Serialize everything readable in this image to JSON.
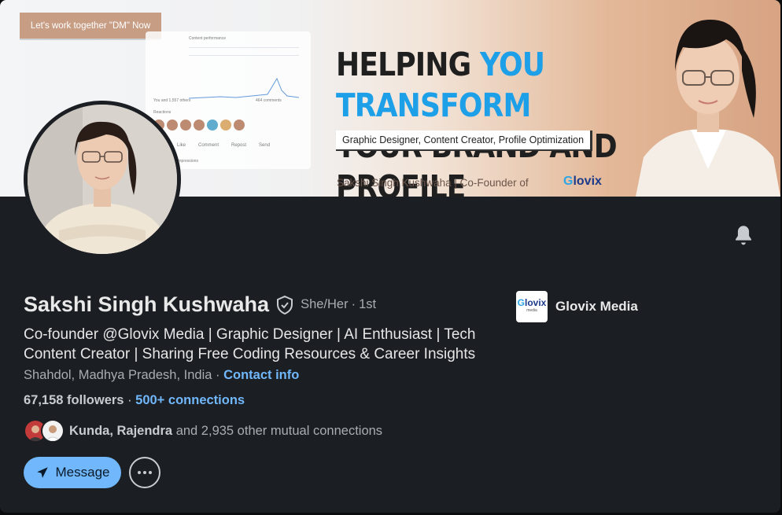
{
  "banner": {
    "tag_chip": "Let's work together \"DM\" Now",
    "mock_post": {
      "title": "Content performance",
      "reactions_line": "You and 1,557 others",
      "comments": "464 comments",
      "reactions_label": "Reactions",
      "actions": [
        "Like",
        "Comment",
        "Repost",
        "Send"
      ],
      "impressions": "Impressions"
    },
    "headline_part1": "HELPING ",
    "headline_highlight": "YOU TRANSFORM",
    "headline_line2": "YOUR BRAND AND PROFILE",
    "subtag": "Graphic Designer, Content Creator, Profile Optimization",
    "byline": "Sakshi Singh Kushwaha | Co-Founder of",
    "byline_logo_g": "G",
    "byline_logo_rest": "lovix"
  },
  "profile": {
    "name": "Sakshi Singh Kushwaha",
    "pronouns": "She/Her",
    "separator": "·",
    "degree": "1st",
    "bio": "Co-founder @Glovix Media | Graphic Designer  | AI Enthusiast | Tech Content Creator  | Sharing Free Coding Resources & Career Insights",
    "location": "Shahdol, Madhya Pradesh, India",
    "location_sep": " · ",
    "contact_info": "Contact info",
    "followers": "67,158 followers",
    "follow_sep": " · ",
    "connections": "500+ connections",
    "mutual_names": "Kunda, Rajendra",
    "mutual_rest": " and 2,935 other mutual connections"
  },
  "company": {
    "logo_g": "G",
    "logo_rest": "lovix",
    "logo_sub": "media",
    "name": "Glovix Media"
  },
  "actions": {
    "message_label": "Message",
    "more_icon": "ellipsis-icon",
    "bell_icon": "bell-icon"
  },
  "colors": {
    "card_bg": "#1b1f23",
    "link": "#71b7fb",
    "accent_banner": "#1ea0e8"
  }
}
